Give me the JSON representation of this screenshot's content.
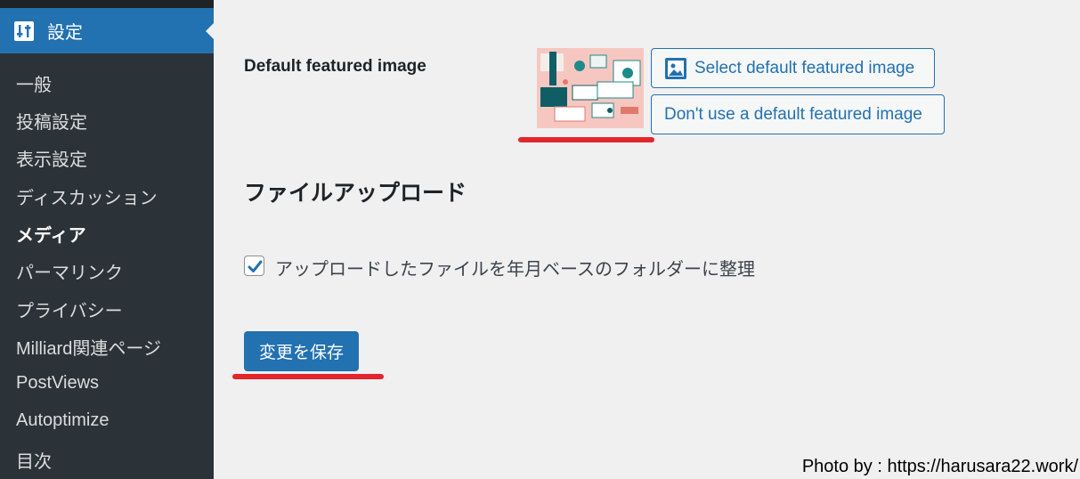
{
  "sidebar": {
    "active_menu": {
      "label": "設定",
      "icon": "settings-sliders-icon"
    },
    "items": [
      {
        "label": "一般"
      },
      {
        "label": "投稿設定"
      },
      {
        "label": "表示設定"
      },
      {
        "label": "ディスカッション"
      },
      {
        "label": "メディア",
        "current": true
      },
      {
        "label": "パーマリンク"
      },
      {
        "label": "プライバシー"
      },
      {
        "label": "Milliard関連ページ"
      },
      {
        "label": "PostViews"
      },
      {
        "label": "Autoptimize"
      },
      {
        "label": "目次"
      }
    ]
  },
  "main": {
    "default_featured_image": {
      "label": "Default featured image",
      "select_button": "Select default featured image",
      "dont_use_button": "Don't use a default featured image",
      "select_icon": "media-library-icon"
    },
    "file_upload": {
      "title": "ファイルアップロード",
      "organize_checkbox_label": "アップロードしたファイルを年月ベースのフォルダーに整理",
      "organize_checked": true
    },
    "save_button": "変更を保存"
  },
  "credit": "Photo by : https://harusara22.work/",
  "colors": {
    "accent": "#2271b1",
    "sidebar": "#1d2327",
    "submenu": "#2c3338",
    "highlight_underline": "#e3262b"
  }
}
